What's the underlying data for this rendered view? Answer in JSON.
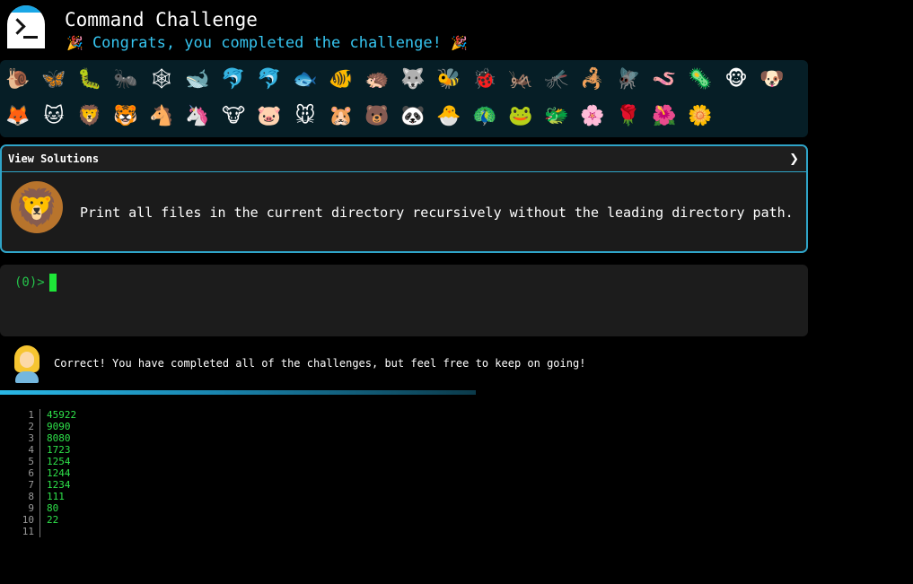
{
  "header": {
    "title": "Command Challenge",
    "congrats": "Congrats, you completed the challenge!",
    "party_emoji": "🎉"
  },
  "animals": {
    "row1": [
      "🐌",
      "🦋",
      "🐛",
      "🐜",
      "🕸",
      "🐋",
      "🐬",
      "🐬",
      "🐟",
      "🐠",
      "🦔",
      "🐺",
      "🐝",
      "🐞",
      "🦗",
      "🦟",
      "🦂",
      "🪰",
      "🪱",
      "🦠",
      "🐵",
      "🐶"
    ],
    "row2": [
      "🦊",
      "🐱",
      "🦁",
      "🐯",
      "🐴",
      "🦄",
      "🐮",
      "🐷",
      "🐭",
      "🐹",
      "🐻",
      "🐼",
      "🐣",
      "🦚",
      "🐸",
      "🐲",
      "🌸",
      "🌹",
      "🌺",
      "🌼"
    ]
  },
  "solutions": {
    "label": "View Solutions",
    "chevron": "❯",
    "avatar": "🦁",
    "task": "Print all files in the current directory recursively without the leading directory path."
  },
  "terminal": {
    "prompt": "(0)>"
  },
  "result": {
    "text": "Correct! You have completed all of the challenges, but feel free to keep on going!",
    "progress": 1.0
  },
  "output": {
    "lines": [
      {
        "num": "1",
        "value": "45922"
      },
      {
        "num": "2",
        "value": "9090"
      },
      {
        "num": "3",
        "value": "8080"
      },
      {
        "num": "4",
        "value": "1723"
      },
      {
        "num": "5",
        "value": "1254"
      },
      {
        "num": "6",
        "value": "1244"
      },
      {
        "num": "7",
        "value": "1234"
      },
      {
        "num": "8",
        "value": "111"
      },
      {
        "num": "9",
        "value": "80"
      },
      {
        "num": "10",
        "value": "22"
      },
      {
        "num": "11",
        "value": ""
      }
    ]
  },
  "colors": {
    "accent": "#36c5f0",
    "border": "#2fa4c8",
    "prompt": "#25c24a",
    "output_text": "#2ee24a"
  }
}
